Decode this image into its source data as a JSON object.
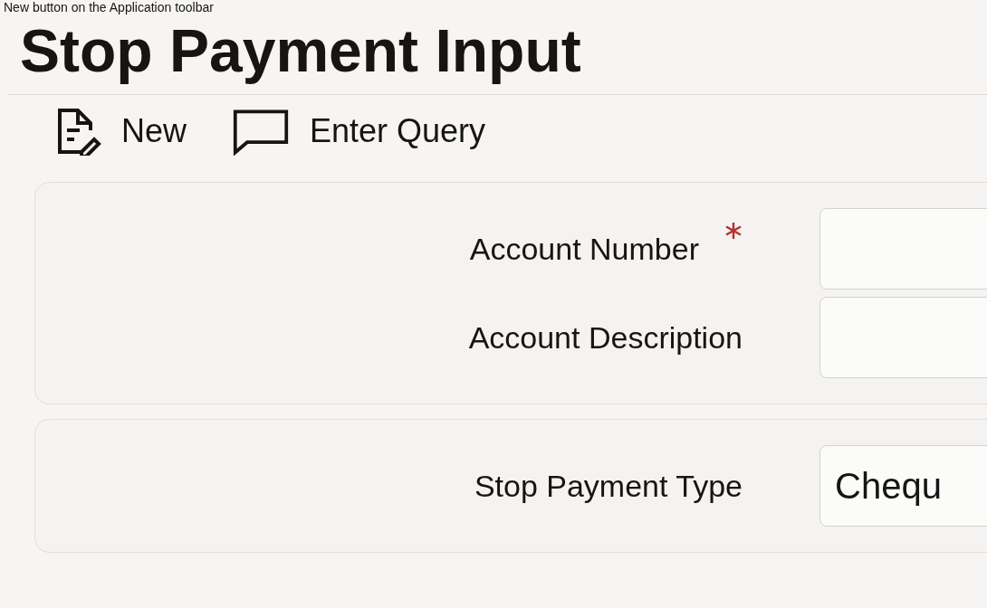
{
  "caption": "New button on the Application toolbar",
  "title": "Stop Payment Input",
  "toolbar": [
    {
      "label": "New",
      "kind": "new"
    },
    {
      "label": "Enter Query",
      "kind": "query"
    }
  ],
  "sections": [
    {
      "fields": [
        {
          "label": "Account Number",
          "required": true
        },
        {
          "label": "Account Description",
          "required": false
        }
      ]
    },
    {
      "fields": [
        {
          "label": "Stop Payment Type",
          "required": false,
          "value": "Chequ"
        }
      ]
    }
  ]
}
